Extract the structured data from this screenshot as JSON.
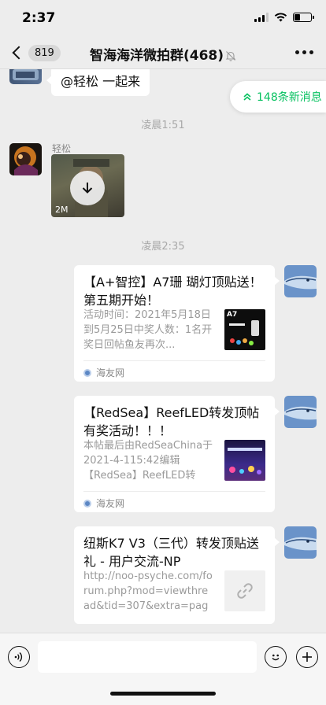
{
  "status_bar": {
    "time": "2:37"
  },
  "nav": {
    "unread_count": "819",
    "title": "智海海洋微拍群(468)"
  },
  "new_messages_pill": {
    "label": "148条新消息"
  },
  "messages": {
    "first_text": "@轻松 一起来",
    "time_1": "凌晨1:51",
    "sender_name": "轻松",
    "image_size": "2M",
    "time_2": "凌晨2:35"
  },
  "cards": [
    {
      "title": "【A+智控】A7珊 瑚灯顶贴送！第五期开始！",
      "description": "活动时间：2021年5月18日到5月25日中奖人数：1名开奖日回帖鱼友再次...",
      "thumb_label": "A7",
      "source": "海友网"
    },
    {
      "title": "【RedSea】ReefLED转发顶帖有奖活动！！！",
      "description": "本帖最后由RedSeaChina于2021-4-115:42编辑【RedSea】ReefLED转发...",
      "source": "海友网"
    },
    {
      "title": "纽斯K7 V3（三代）转发顶贴送礼 - 用户交流-NP",
      "description": "http://noo-psyche.com/forum.php?mod=viewthread&tid=307&extra=page..."
    }
  ],
  "icons": {
    "back": "chevron-left-icon",
    "mute": "bell-off-icon",
    "more": "more-dots-icon",
    "new_msg": "double-chevron-up-icon",
    "download": "download-arrow-icon",
    "link": "link-icon",
    "voice": "voice-icon",
    "emoji": "emoji-icon",
    "plus": "plus-icon"
  },
  "colors": {
    "accent_green": "#07c160",
    "background": "#ededed"
  }
}
